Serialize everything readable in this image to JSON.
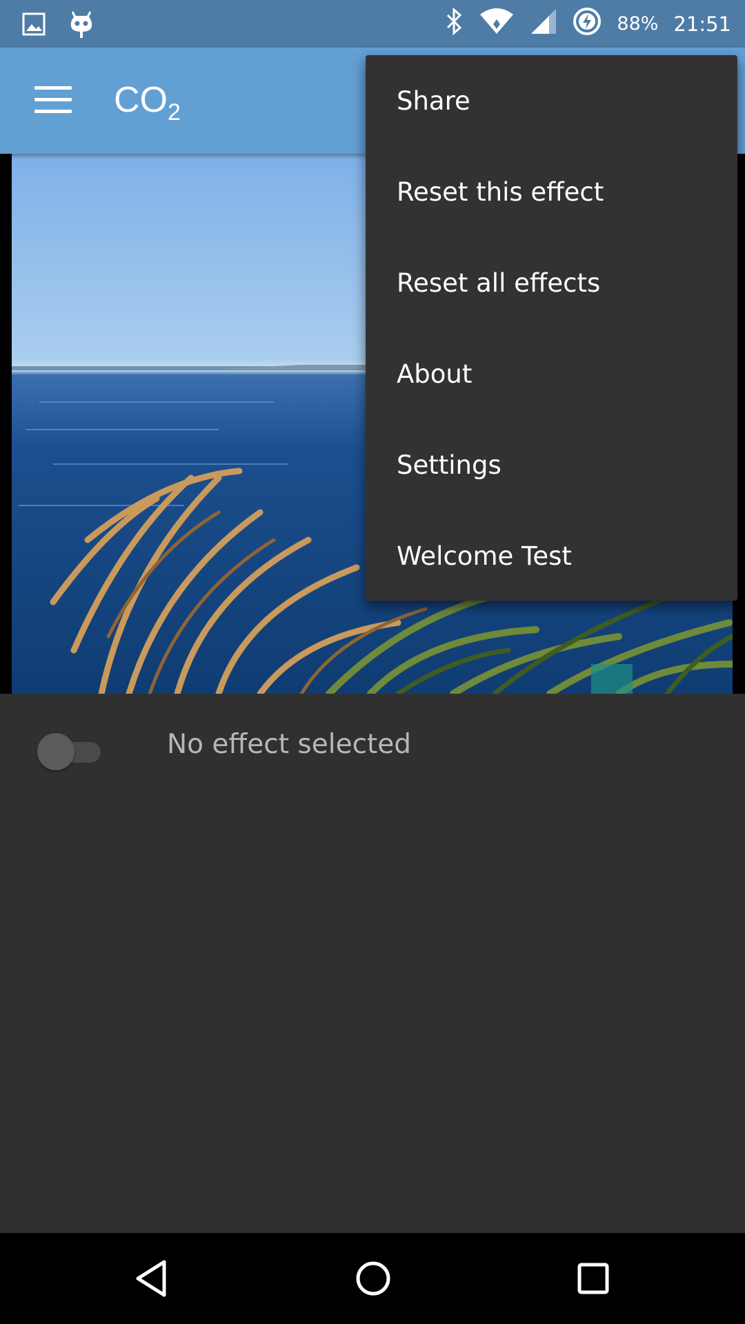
{
  "status_bar": {
    "battery": "88%",
    "time": "21:51",
    "icons": [
      "gallery-icon",
      "cyanogen-icon",
      "bluetooth-icon",
      "wifi-icon",
      "signal-icon",
      "battery-charging-icon"
    ]
  },
  "app_bar": {
    "title": "CO",
    "title_subscript": "2"
  },
  "overflow_menu": {
    "items": [
      "Share",
      "Reset this effect",
      "Reset all effects",
      "About",
      "Settings",
      "Welcome Test"
    ]
  },
  "effect_panel": {
    "toggle_state": "off",
    "label": "No effect selected"
  },
  "colors": {
    "status_bar": "#4e7ca6",
    "app_bar": "#629fd3",
    "background": "#303030",
    "menu": "#323232"
  }
}
